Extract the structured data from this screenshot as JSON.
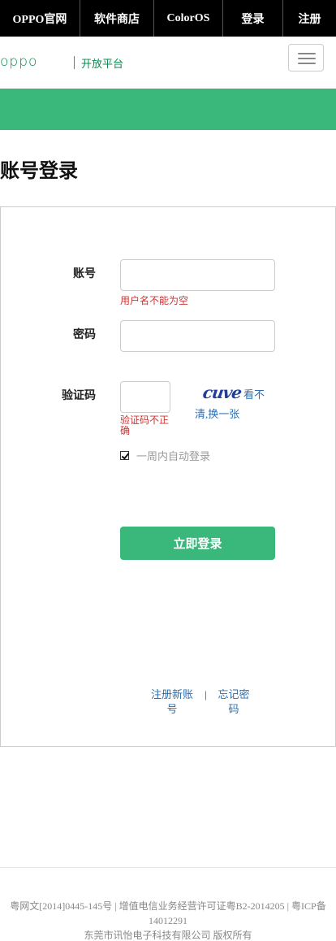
{
  "topnav": {
    "items": [
      "OPPO官网",
      "软件商店",
      "ColorOS",
      "登录",
      "注册"
    ]
  },
  "brand": {
    "logo_text": "oppo",
    "subtitle": "开放平台"
  },
  "page": {
    "title": "账号登录"
  },
  "form": {
    "account_label": "账号",
    "account_value": "",
    "account_error": "用户名不能为空",
    "password_label": "密码",
    "password_value": "",
    "captcha_label": "验证码",
    "captcha_value": "",
    "captcha_error": "验证码不正确",
    "captcha_image_text": "cuve",
    "captcha_refresh": "看不清,换一张",
    "remember_label": "一周内自动登录",
    "remember_checked": true,
    "submit_label": "立即登录"
  },
  "links": {
    "register": "注册新账号",
    "forgot": "忘记密码",
    "separator": "|"
  },
  "footer": {
    "line1": "粤网文[2014]0445-145号 | 增值电信业务经营许可证粤B2-2014205 | 粤ICP备14012291",
    "line2": "东莞市讯怡电子科技有限公司 版权所有"
  },
  "colors": {
    "brand_green": "#3ab77a",
    "error_red": "#cc3333",
    "link_blue": "#2a6fb0"
  }
}
